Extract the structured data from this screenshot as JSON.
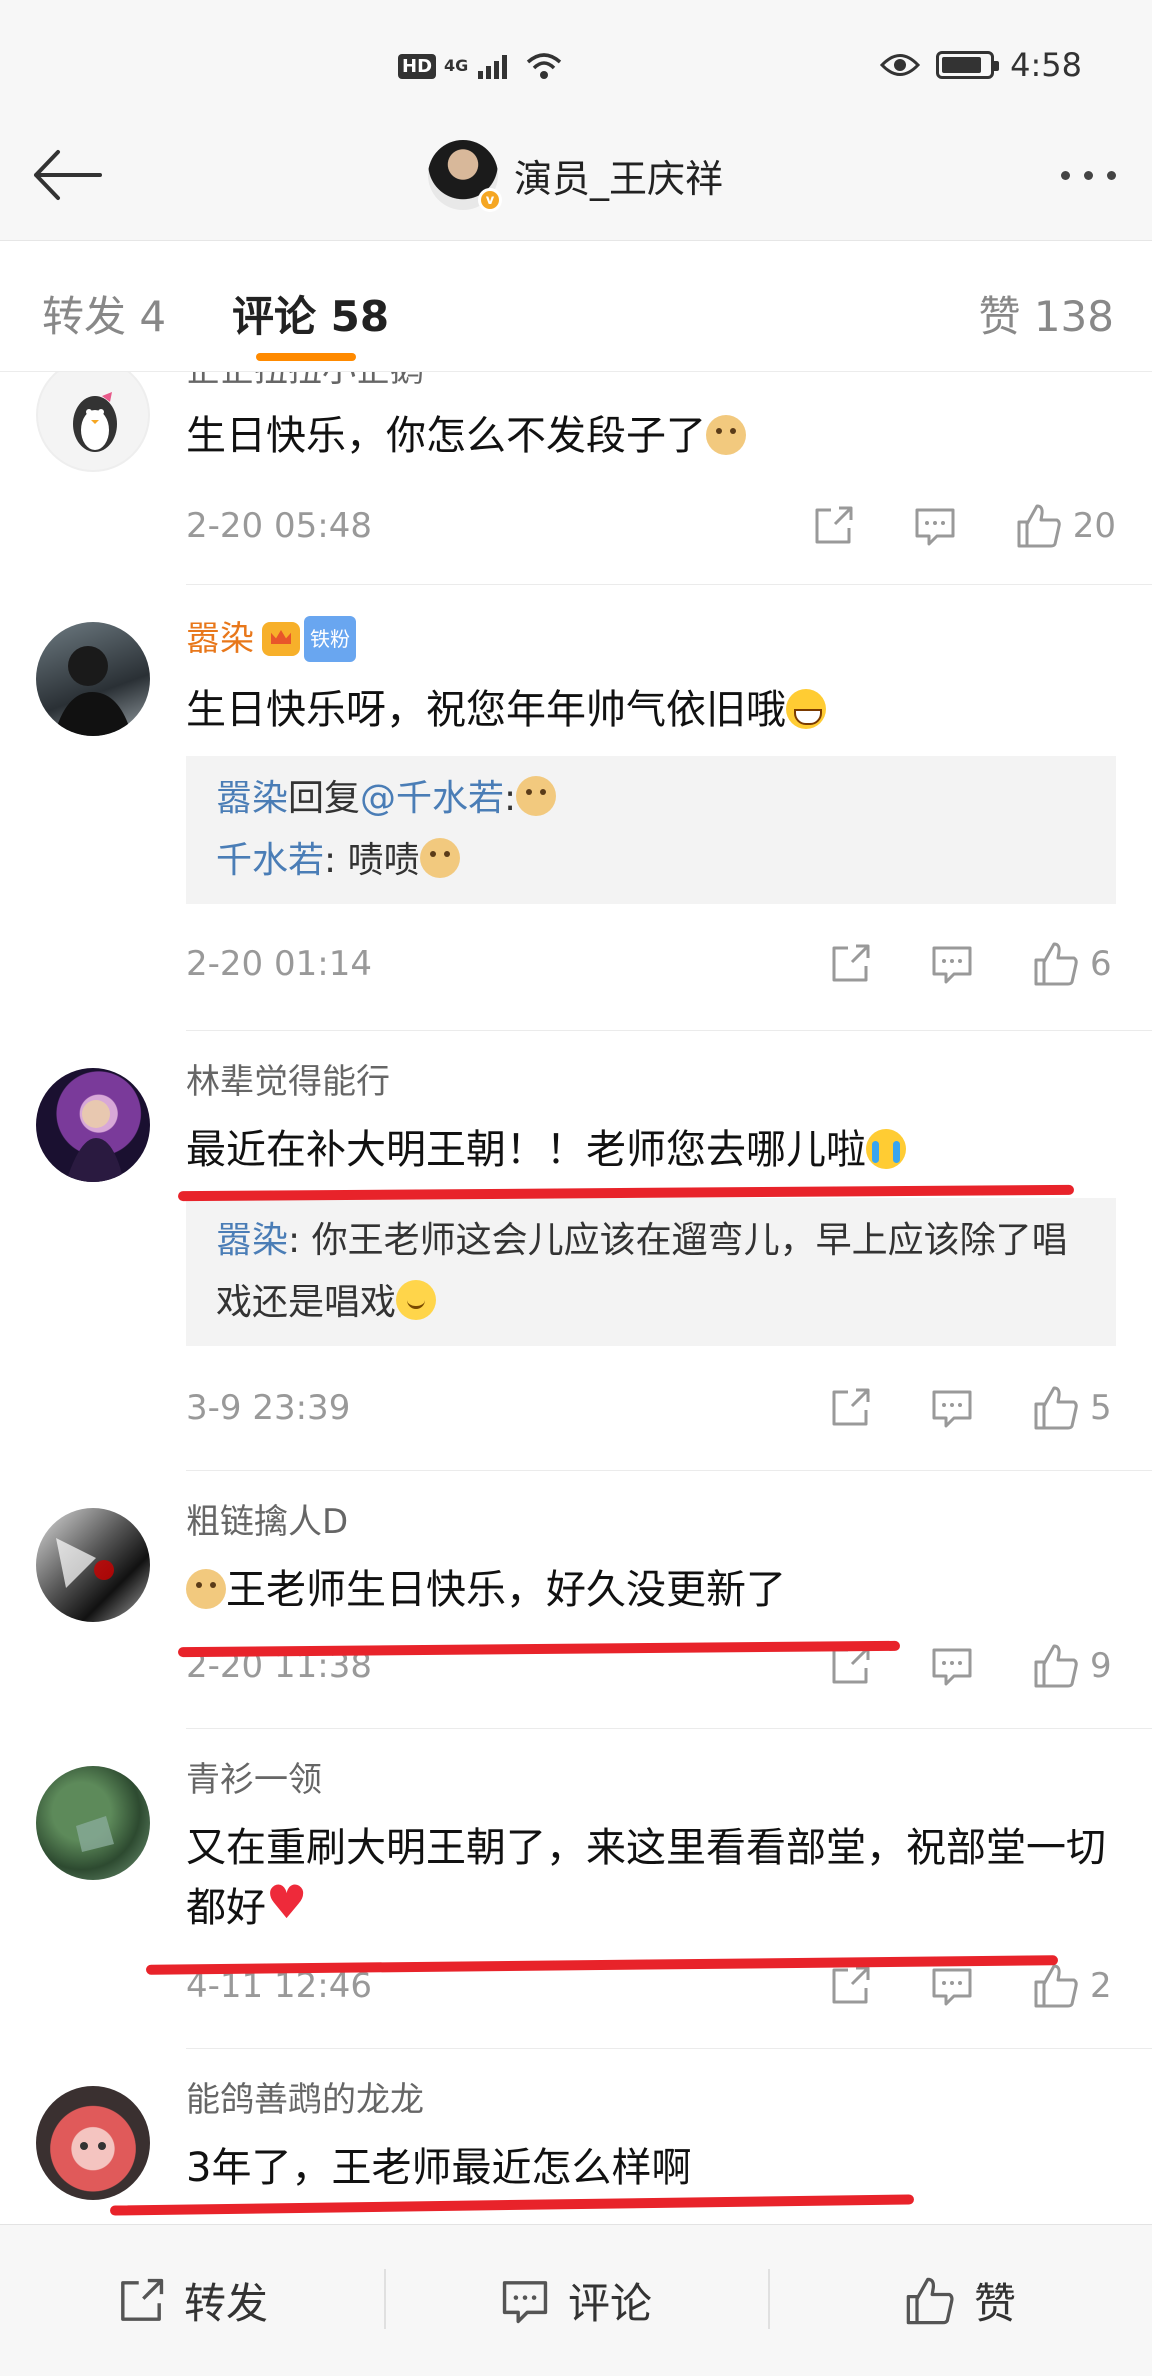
{
  "status_bar": {
    "hd": "HD",
    "network": "4G",
    "time": "4:58",
    "battery_level": 0.85
  },
  "header": {
    "title": "演员_王庆祥"
  },
  "tabs": {
    "repost_label": "转发 4",
    "comment_label": "评论 58",
    "like_label": "赞 138"
  },
  "comments": [
    {
      "username": "企企扭扭小企鹅",
      "text": "生日快乐，你怎么不发段子了",
      "date": "2-20 05:48",
      "likes": "20",
      "emoji": "doge"
    },
    {
      "username": "嚣染",
      "badge": "铁粉",
      "text": "生日快乐呀，祝您年年帅气依旧哦",
      "date": "2-20 01:14",
      "likes": "6",
      "emoji": "grin",
      "replies": [
        {
          "name": "嚣染",
          "mid": "回复",
          "mention": "@千水若",
          "text": ":"
        },
        {
          "name": "千水若",
          "text": ": 啧啧"
        }
      ]
    },
    {
      "username": "林辈觉得能行",
      "text": "最近在补大明王朝！！老师您去哪儿啦",
      "date": "3-9 23:39",
      "likes": "5",
      "emoji": "cry",
      "replies": [
        {
          "name": "嚣染",
          "text": ": 你王老师这会儿应该在遛弯儿，早上应该除了唱戏还是唱戏"
        }
      ]
    },
    {
      "username": "粗链擒人D",
      "text": "王老师生日快乐，好久没更新了",
      "date": "2-20 11:38",
      "likes": "9",
      "emoji": "doge"
    },
    {
      "username": "青衫一领",
      "text": "又在重刷大明王朝了，来这里看看部堂，祝部堂一切都好",
      "date": "4-11 12:46",
      "likes": "2",
      "emoji": "heart"
    },
    {
      "username": "能鸽善鹉的龙龙",
      "text": "3年了，王老师最近怎么样啊"
    }
  ],
  "bottom_bar": {
    "repost": "转发",
    "comment": "评论",
    "like": "赞"
  },
  "colors": {
    "accent": "#ff8a00",
    "link": "#4a7db6",
    "annotation_red": "#e8232a",
    "username_highlight": "#e8771a"
  }
}
